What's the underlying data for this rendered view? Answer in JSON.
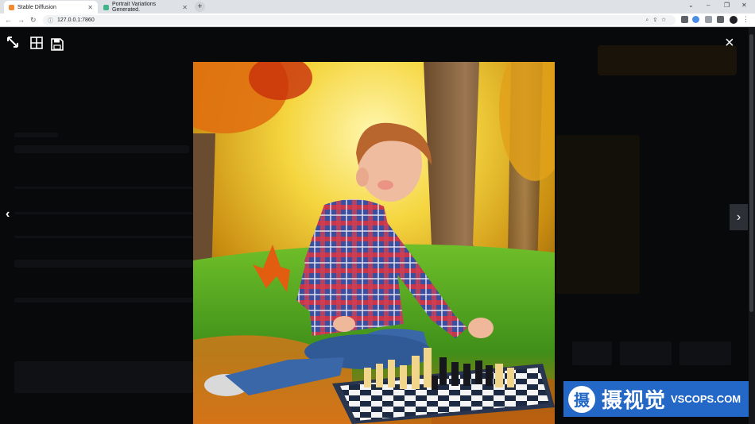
{
  "browser": {
    "tabs": [
      {
        "title": "Stable Diffusion",
        "active": true,
        "favicon_color": "#f28b30"
      },
      {
        "title": "Portrait Variations Generated.",
        "active": false,
        "favicon_color": "#3fb58a"
      }
    ],
    "new_tab_symbol": "+",
    "url": "127.0.0.1:7860",
    "window_controls": {
      "collapse": "⌄",
      "minimize": "–",
      "restore": "❐",
      "close": "✕"
    }
  },
  "lightbox": {
    "toolbar_icons": [
      "fullscreen-arrows-icon",
      "tile-grid-icon",
      "save-disk-icon"
    ],
    "close_symbol": "×",
    "prev_symbol": "‹",
    "next_symbol": "›",
    "image_subject": "boy-playing-chess-in-autumn-park"
  },
  "watermark": {
    "logo_char": "摄",
    "text_cn": "摄视觉",
    "text_en": "VSCOPS.COM",
    "color": "#2468c7"
  },
  "colors": {
    "overlay": "#000000",
    "next_button_bg": "#2c3036",
    "active_tab": "#ffffff"
  }
}
